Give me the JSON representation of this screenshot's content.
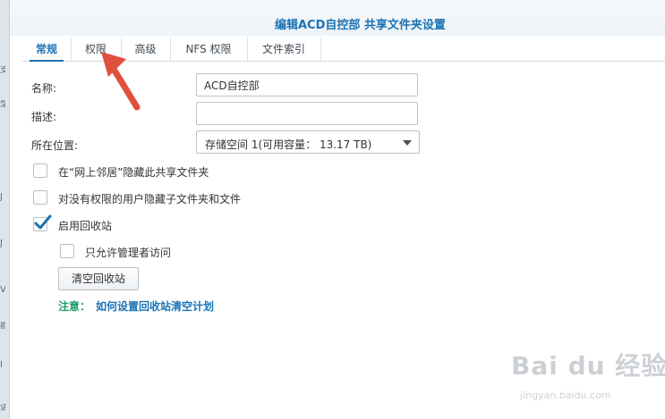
{
  "window": {
    "title": "编辑ACD自控部 共享文件夹设置"
  },
  "tabs": [
    {
      "label": "常规",
      "active": true
    },
    {
      "label": "权限",
      "active": false
    },
    {
      "label": "高级",
      "active": false
    },
    {
      "label": "NFS 权限",
      "active": false
    },
    {
      "label": "文件索引",
      "active": false
    }
  ],
  "form": {
    "name_label": "名称:",
    "name_value": "ACD自控部",
    "desc_label": "描述:",
    "desc_value": "",
    "location_label": "所在位置:",
    "location_value": "存储空间 1(可用容量： 13.17 TB)"
  },
  "options": {
    "hide_network": {
      "label": "在“网上邻居”隐藏此共享文件夹",
      "checked": false
    },
    "hide_subfolders": {
      "label": "对没有权限的用户隐藏子文件夹和文件",
      "checked": false
    },
    "recycle_bin": {
      "label": "启用回收站",
      "checked": true
    },
    "admin_only": {
      "label": "只允许管理者访问",
      "checked": false
    }
  },
  "buttons": {
    "empty_recycle": "清空回收站"
  },
  "note": {
    "prefix": "注意：",
    "link": "如何设置回收站清空计划"
  },
  "watermark": {
    "logo": "Bai du 经验",
    "url": "jingyan.baidu.com"
  },
  "colors": {
    "accent": "#1a73b5",
    "note_green": "#1f9c6a",
    "check": "#1a73b5",
    "arrow": "#e0503e"
  }
}
